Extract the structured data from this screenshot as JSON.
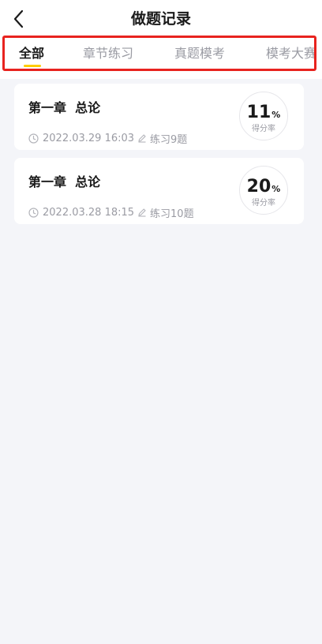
{
  "header": {
    "title": "做题记录",
    "back_icon": "chevron-left-icon"
  },
  "tabs": [
    {
      "label": "全部",
      "active": true
    },
    {
      "label": "章节练习",
      "active": false
    },
    {
      "label": "真题模考",
      "active": false
    },
    {
      "label": "模考大赛",
      "active": false
    }
  ],
  "colors": {
    "accent_underline": "#ffcc00",
    "highlight_border": "#e8231f",
    "background": "#f4f5f9"
  },
  "records": [
    {
      "title": "第一章  总论",
      "date": "2022.03.29 16:03",
      "exercise": "练习9题",
      "score": "11",
      "unit": "%",
      "score_label": "得分率"
    },
    {
      "title": "第一章  总论",
      "date": "2022.03.28 18:15",
      "exercise": "练习10题",
      "score": "20",
      "unit": "%",
      "score_label": "得分率"
    }
  ]
}
